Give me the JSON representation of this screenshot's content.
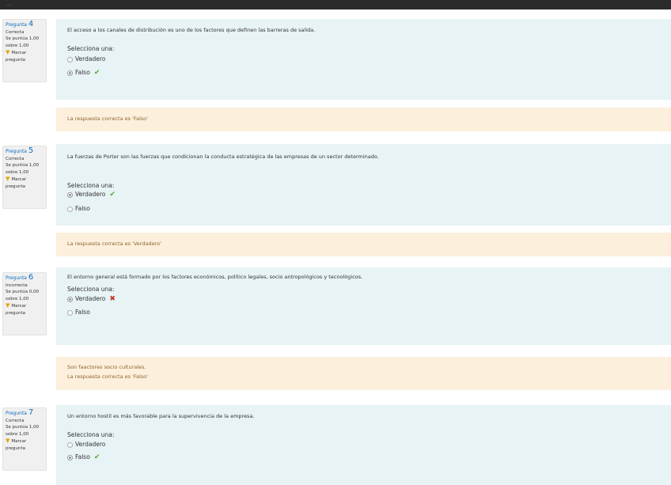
{
  "topbar": {
    "text": "..."
  },
  "questions": [
    {
      "prefix": "Pregunta",
      "number": "4",
      "status": "Correcta",
      "score": "Se puntúa 1,00",
      "score_over": "sobre 1,00",
      "flag_label": "Marcar",
      "flag_label2": "pregunta",
      "text": "El acceso a los canales de distribución es uno de los factores que definen las barreras de salida.",
      "prompt": "Selecciona una:",
      "options": [
        {
          "label": "Verdadero",
          "selected": false,
          "mark": ""
        },
        {
          "label": "Falso",
          "selected": true,
          "mark": "correct"
        }
      ],
      "feedback": [
        "La respuesta correcta es 'Falso'"
      ]
    },
    {
      "prefix": "Pregunta",
      "number": "5",
      "status": "Correcta",
      "score": "Se puntúa 1,00",
      "score_over": "sobre 1,00",
      "flag_label": "Marcar",
      "flag_label2": "pregunta",
      "text": "La fuerzas de Porter son las fuerzas que condicionan la conducta estratégica de las empresas de un sector determinado.",
      "prompt": "Selecciona una:",
      "options": [
        {
          "label": "Verdadero",
          "selected": true,
          "mark": "correct"
        },
        {
          "label": "Falso",
          "selected": false,
          "mark": ""
        }
      ],
      "feedback": [
        "La respuesta correcta es 'Verdadero'"
      ]
    },
    {
      "prefix": "Pregunta",
      "number": "6",
      "status": "Incorrecta",
      "score": "Se puntúa 0,00",
      "score_over": "sobre 1,00",
      "flag_label": "Marcar",
      "flag_label2": "pregunta",
      "text": "El entorno general está formado por los factores económicos, político legales, socio antropológicos y tecnológicos.",
      "prompt": "Selecciona una:",
      "options": [
        {
          "label": "Verdadero",
          "selected": true,
          "mark": "incorrect"
        },
        {
          "label": "Falso",
          "selected": false,
          "mark": ""
        }
      ],
      "feedback": [
        "Son faactores socio culturales.",
        "La respuesta correcta es 'Falso'"
      ]
    },
    {
      "prefix": "Pregunta",
      "number": "7",
      "status": "Correcta",
      "score": "Se puntúa 1,00",
      "score_over": "sobre 1,00",
      "flag_label": "Marcar",
      "flag_label2": "pregunta",
      "text": "Un entorno hostil es más favorable para la supervivencia de la empresa.",
      "prompt": "Selecciona una:",
      "options": [
        {
          "label": "Verdadero",
          "selected": false,
          "mark": ""
        },
        {
          "label": "Falso",
          "selected": true,
          "mark": "correct"
        }
      ],
      "feedback": []
    }
  ]
}
